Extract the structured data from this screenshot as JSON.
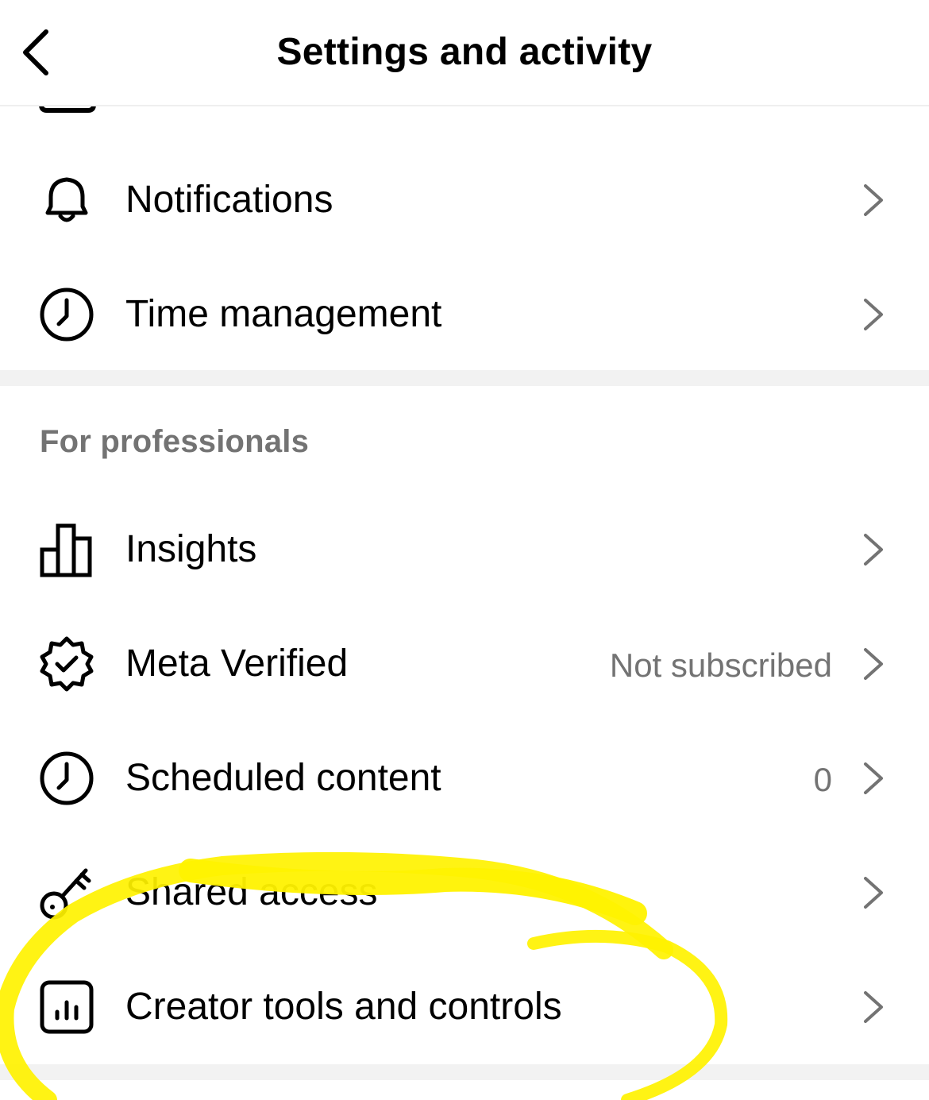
{
  "header": {
    "title": "Settings and activity",
    "back_icon": "chevron-left-icon"
  },
  "account_section": {
    "items": [
      {
        "label": "Notifications",
        "icon": "bell-icon"
      },
      {
        "label": "Time management",
        "icon": "clock-icon"
      }
    ]
  },
  "professionals_section": {
    "title": "For professionals",
    "items": [
      {
        "label": "Insights",
        "icon": "bar-chart-icon",
        "value": ""
      },
      {
        "label": "Meta Verified",
        "icon": "verified-badge-icon",
        "value": "Not subscribed"
      },
      {
        "label": "Scheduled content",
        "icon": "clock-icon",
        "value": "0"
      },
      {
        "label": "Shared access",
        "icon": "key-icon",
        "value": ""
      },
      {
        "label": "Creator tools and controls",
        "icon": "creator-tools-icon",
        "value": ""
      }
    ]
  },
  "colors": {
    "highlight": "#fff200",
    "secondary_text": "#737373",
    "divider": "#f2f2f2"
  }
}
